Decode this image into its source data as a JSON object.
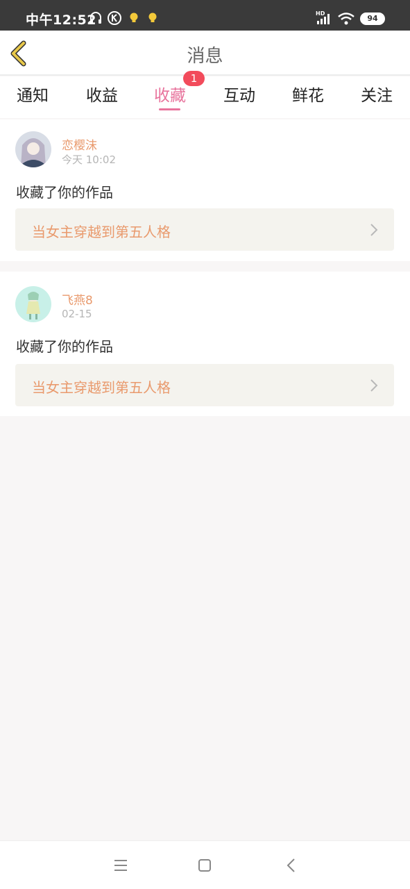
{
  "status_bar": {
    "time": "中午12:52",
    "battery": "94",
    "hd_label": "HD",
    "icons": [
      "headset-icon",
      "k-app-icon",
      "bulb-icon",
      "bulb-icon",
      "signal-icon",
      "wifi-icon",
      "battery-icon"
    ]
  },
  "header": {
    "title": "消息",
    "back_icon": "back-chevron-icon"
  },
  "tabs": [
    {
      "label": "通知"
    },
    {
      "label": "收益"
    },
    {
      "label": "收藏",
      "active": true,
      "badge": "1"
    },
    {
      "label": "互动"
    },
    {
      "label": "鲜花"
    },
    {
      "label": "关注"
    }
  ],
  "messages": [
    {
      "user": "恋樱沫",
      "time": "今天 10:02",
      "action": "收藏了你的作品",
      "work_title": "当女主穿越到第五人格"
    },
    {
      "user": "飞燕8",
      "time": "02-15",
      "action": "收藏了你的作品",
      "work_title": "当女主穿越到第五人格"
    }
  ],
  "colors": {
    "accent_pink": "#e8739c",
    "accent_orange": "#e99a6d",
    "badge_red": "#f24b5b",
    "back_arrow": "#e8c84a"
  },
  "nav_bar": {
    "icons": [
      "menu-icon",
      "home-icon",
      "back-icon"
    ]
  }
}
